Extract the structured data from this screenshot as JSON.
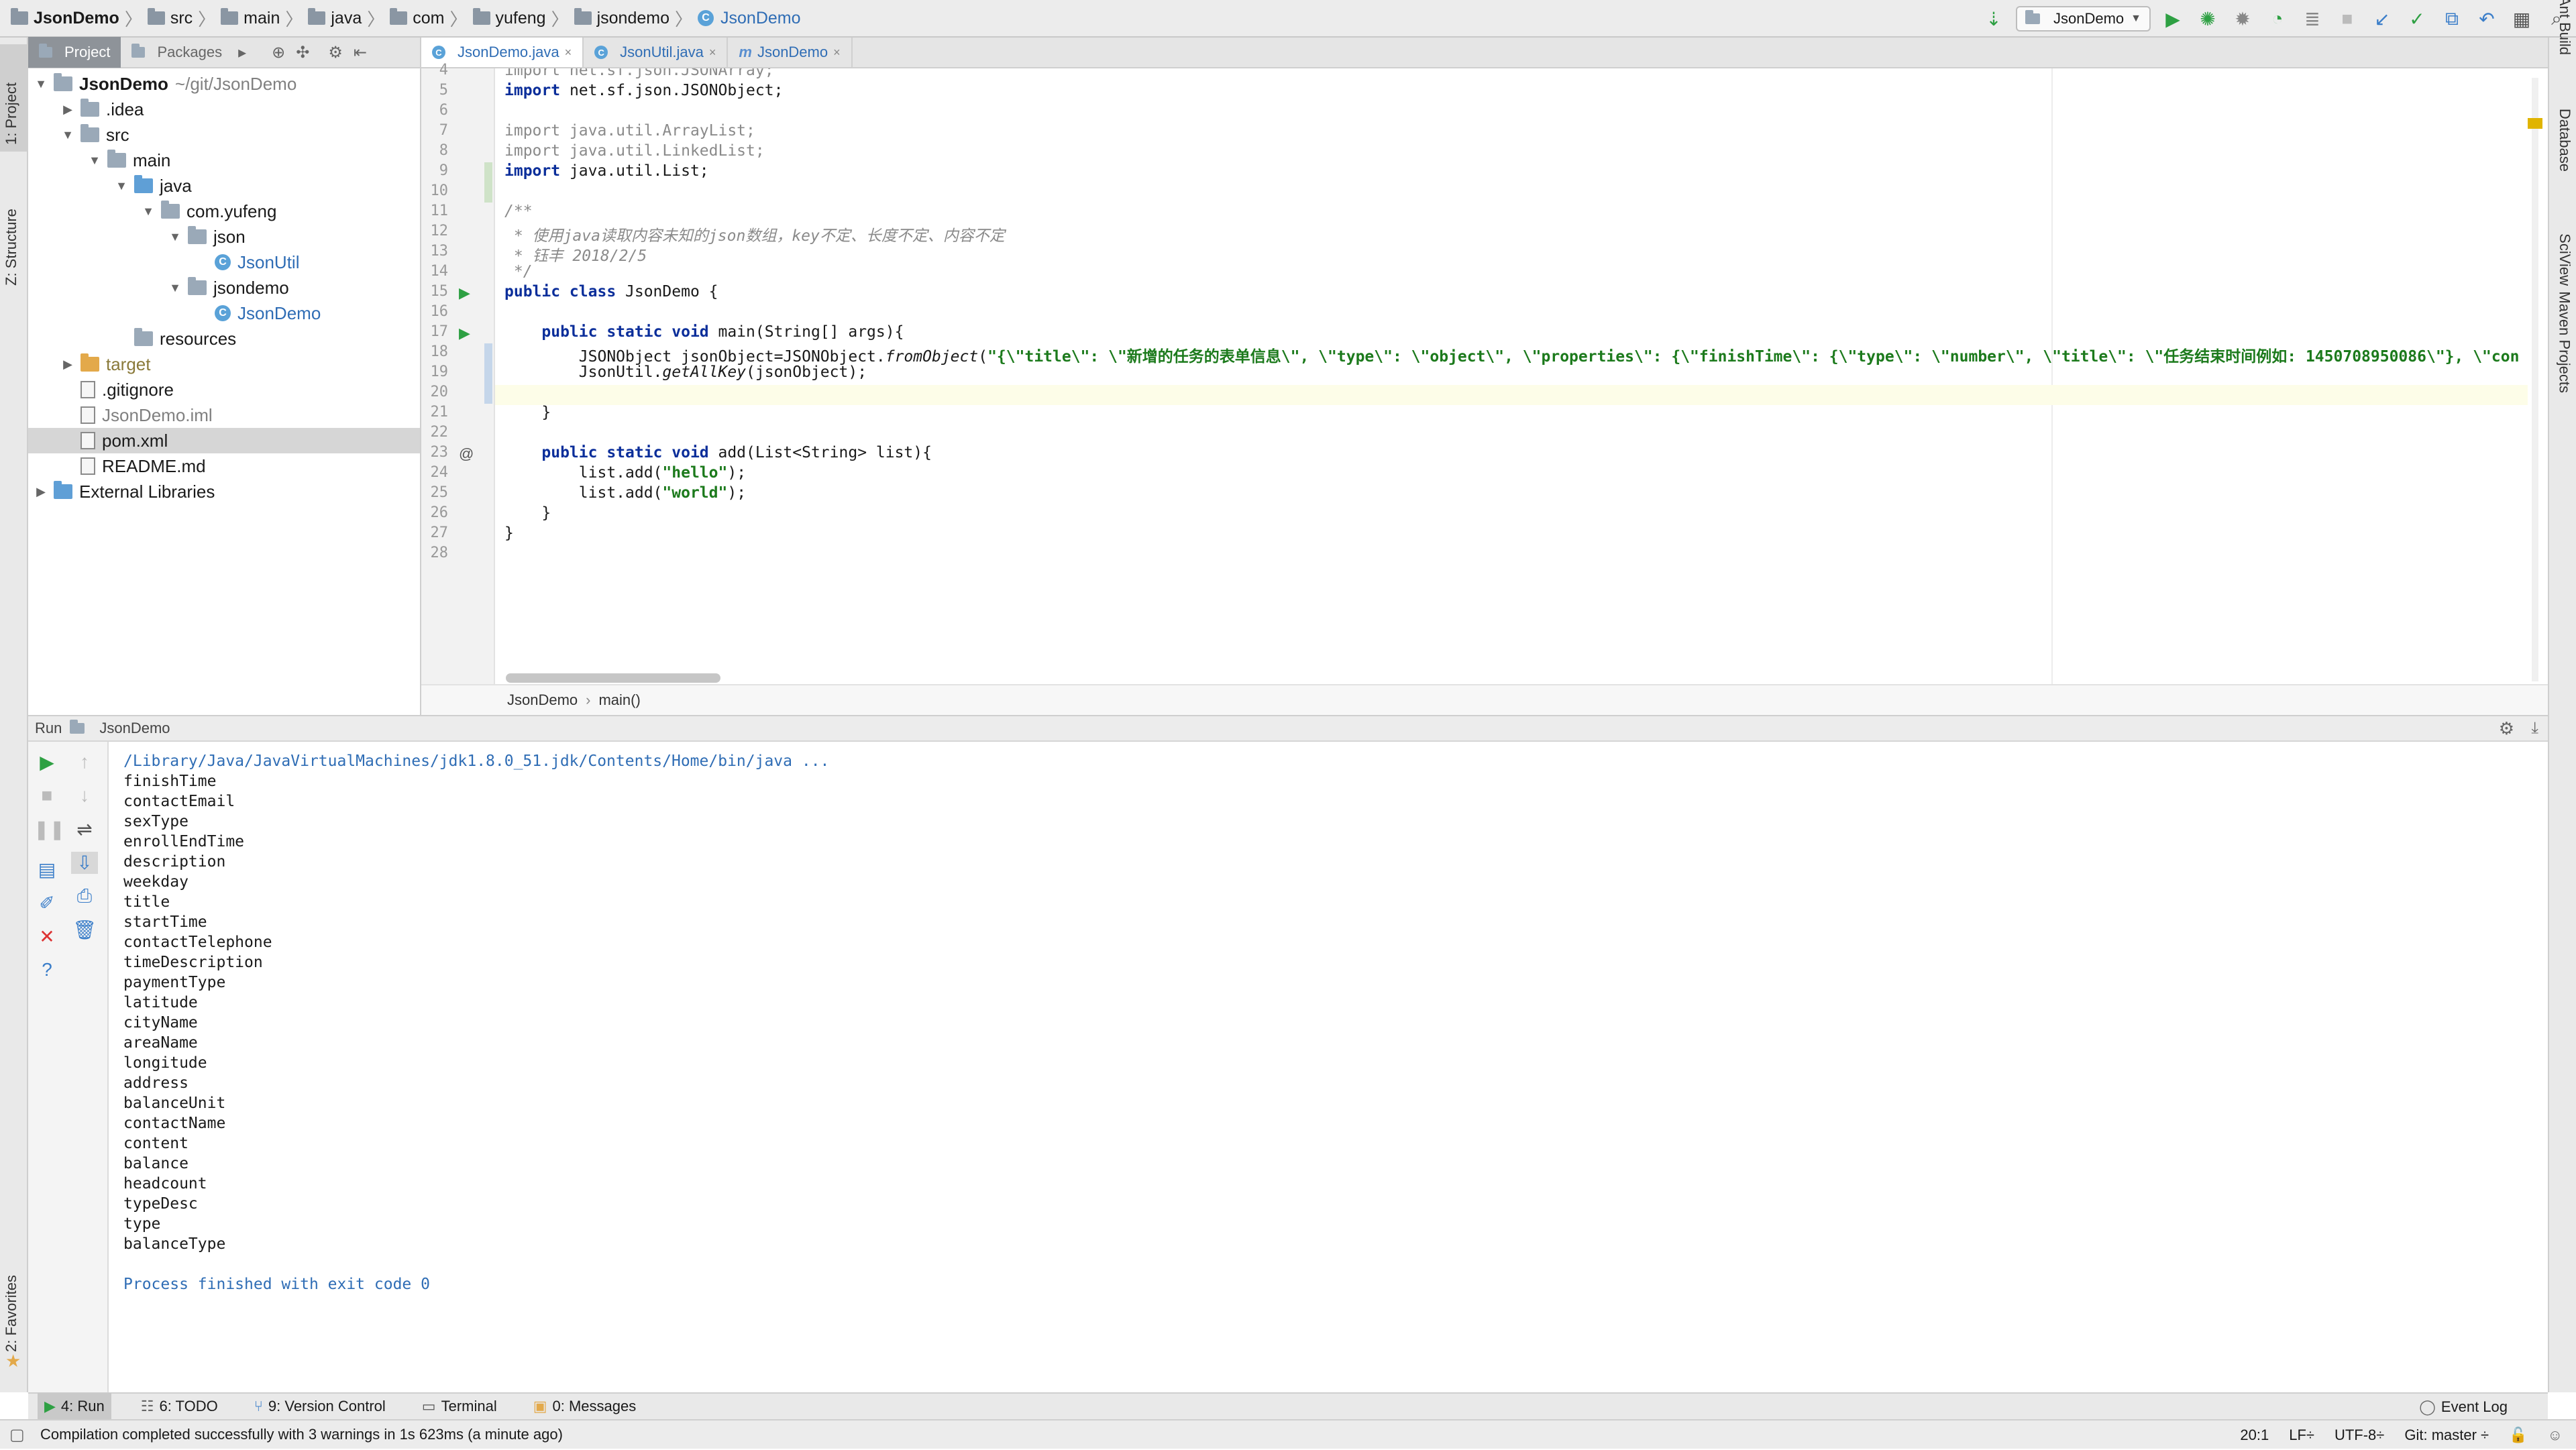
{
  "navbar": {
    "crumbs": [
      "JsonDemo",
      "src",
      "main",
      "java",
      "com",
      "yufeng",
      "jsondemo",
      "JsonDemo"
    ],
    "run_config": "JsonDemo"
  },
  "left_strip": {
    "project": "1: Project",
    "structure": "Z: Structure",
    "favorites": "2: Favorites"
  },
  "right_strip": {
    "ant": "Ant Build",
    "database": "Database",
    "sciview": "SciView",
    "maven": "Maven Projects"
  },
  "project_panel": {
    "tabs": [
      "Project",
      "Packages"
    ],
    "tree": [
      {
        "label": "JsonDemo",
        "extra": "~/git/JsonDemo",
        "depth": 0,
        "arrow": "▼",
        "icon": "folder",
        "style": "bold"
      },
      {
        "label": ".idea",
        "depth": 1,
        "arrow": "▶",
        "icon": "folder"
      },
      {
        "label": "src",
        "depth": 1,
        "arrow": "▼",
        "icon": "folder"
      },
      {
        "label": "main",
        "depth": 2,
        "arrow": "▼",
        "icon": "folder"
      },
      {
        "label": "java",
        "depth": 3,
        "arrow": "▼",
        "icon": "folder-blue"
      },
      {
        "label": "com.yufeng",
        "depth": 4,
        "arrow": "▼",
        "icon": "folder"
      },
      {
        "label": "json",
        "depth": 5,
        "arrow": "▼",
        "icon": "folder"
      },
      {
        "label": "JsonUtil",
        "depth": 6,
        "arrow": "",
        "icon": "class",
        "style": "blue"
      },
      {
        "label": "jsondemo",
        "depth": 5,
        "arrow": "▼",
        "icon": "folder"
      },
      {
        "label": "JsonDemo",
        "depth": 6,
        "arrow": "",
        "icon": "class",
        "style": "blue"
      },
      {
        "label": "resources",
        "depth": 3,
        "arrow": "",
        "icon": "folder"
      },
      {
        "label": "target",
        "depth": 1,
        "arrow": "▶",
        "icon": "folder-orange",
        "style": "olive"
      },
      {
        "label": ".gitignore",
        "depth": 1,
        "arrow": "",
        "icon": "file"
      },
      {
        "label": "JsonDemo.iml",
        "depth": 1,
        "arrow": "",
        "icon": "file",
        "style": "gray"
      },
      {
        "label": "pom.xml",
        "depth": 1,
        "arrow": "",
        "icon": "file",
        "style": "selected"
      },
      {
        "label": "README.md",
        "depth": 1,
        "arrow": "",
        "icon": "file"
      },
      {
        "label": "External Libraries",
        "depth": 0,
        "arrow": "▶",
        "icon": "lib"
      }
    ]
  },
  "editor": {
    "tabs": [
      "JsonDemo.java",
      "JsonUtil.java",
      "JsonDemo"
    ],
    "line_numbers": [
      "4",
      "5",
      "6",
      "7",
      "8",
      "9",
      "10",
      "11",
      "12",
      "13",
      "14",
      "15",
      "16",
      "17",
      "18",
      "19",
      "20",
      "21",
      "22",
      "23",
      "24",
      "25",
      "26",
      "27",
      "28"
    ],
    "lines": {
      "l4": "import net.sf.json.JSONArray;",
      "l5": "import net.sf.json.JSONObject;",
      "l7": "import java.util.ArrayList;",
      "l8": "import java.util.LinkedList;",
      "l9": "import java.util.List;",
      "l11": "/**",
      "l12": " * 使用java读取内容未知的json数组，key不定、长度不定、内容不定",
      "l13": " * 钰丰 2018/2/5",
      "l14": " */",
      "l15a": "public class",
      "l15b": " JsonDemo {",
      "l17a": "    public static void",
      "l17b": " main(String[] args){",
      "l18a": "        JSONObject jsonObject=JSONObject.",
      "l18b": "fromObject",
      "l18c": "(",
      "l18d": "\"{\\\"title\\\": \\\"新增的任务的表单信息\\\", \\\"type\\\": \\\"object\\\", \\\"properties\\\": {\\\"finishTime\\\": {\\\"type\\\": \\\"number\\\", \\\"title\\\": \\\"任务结束时间例如: 1450708950086\\\"}, \\\"con",
      "l19a": "        JsonUtil.",
      "l19b": "getAllKey",
      "l19c": "(jsonObject);",
      "l21": "    }",
      "l23a": "    public static void",
      "l23b": " add(List<String> list){",
      "l24a": "        list.add(",
      "l24b": "\"hello\"",
      "l24c": ");",
      "l25a": "        list.add(",
      "l25b": "\"world\"",
      "l25c": ");",
      "l26": "    }",
      "l27": "}"
    },
    "breadcrumb": [
      "JsonDemo",
      "main()"
    ]
  },
  "run_panel": {
    "label": "Run",
    "config": "JsonDemo",
    "java_path": "/Library/Java/JavaVirtualMachines/jdk1.8.0_51.jdk/Contents/Home/bin/java ...",
    "keys": [
      "finishTime",
      "contactEmail",
      "sexType",
      "enrollEndTime",
      "description",
      "weekday",
      "title",
      "startTime",
      "contactTelephone",
      "timeDescription",
      "paymentType",
      "latitude",
      "cityName",
      "areaName",
      "longitude",
      "address",
      "balanceUnit",
      "contactName",
      "content",
      "balance",
      "headcount",
      "typeDesc",
      "type",
      "balanceType"
    ],
    "exit_message": "Process finished with exit code 0"
  },
  "bottom_bar": {
    "run": "4: Run",
    "todo": "6: TODO",
    "vcs": "9: Version Control",
    "terminal": "Terminal",
    "messages": "0: Messages",
    "event_log": "Event Log"
  },
  "status": {
    "message": "Compilation completed successfully with 3 warnings in 1s 623ms (a minute ago)",
    "position": "20:1",
    "line_sep": "LF÷",
    "encoding": "UTF-8÷",
    "git": "Git: master ÷"
  },
  "colors": {
    "accent": "#3b7ec9",
    "keyword": "#0b2e9a",
    "string": "#1c7a1c",
    "run_green": "#2ea043"
  }
}
